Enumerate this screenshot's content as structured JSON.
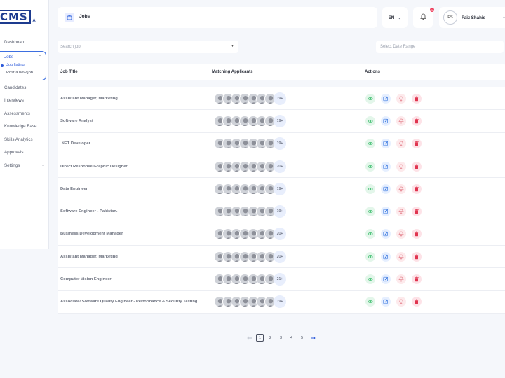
{
  "brand": {
    "logo_text": "CMS",
    "logo_suffix": ".AI"
  },
  "nav": {
    "dashboard": "Dashboard",
    "jobs": "Jobs",
    "job_listing": "Job listing",
    "post_job": "Post a new job",
    "candidates": "Candidates",
    "interviews": "Interviews",
    "assessments": "Assessments",
    "knowledge_base": "Knowledge Base",
    "skills_analytics": "Skills Analytics",
    "approvals": "Approvals",
    "settings": "Settings"
  },
  "header": {
    "title": "Jobs",
    "language": "EN",
    "notification_count": "1",
    "user_initials": "FS",
    "user_name": "Faiz Shahid"
  },
  "filters": {
    "search_placeholder": "Search job",
    "date_placeholder": "Select Date Range"
  },
  "table": {
    "columns": {
      "title": "Job Title",
      "applicants": "Matching Applicants",
      "actions": "Actions"
    },
    "rows": [
      {
        "title": "Assistant Manager, Marketing",
        "more": "19+"
      },
      {
        "title": "Software Analyst",
        "more": "19+"
      },
      {
        "title": ".NET Developer",
        "more": "19+"
      },
      {
        "title": "Direct Response Graphic Designer.",
        "more": "20+"
      },
      {
        "title": "Data Engineer",
        "more": "19+"
      },
      {
        "title": "Software Engineer - Pakistan.",
        "more": "19+"
      },
      {
        "title": "Business Development Manager",
        "more": "20+"
      },
      {
        "title": "Assistant Manager, Marketing",
        "more": "20+"
      },
      {
        "title": "Computer Vision Engineer",
        "more": "21+"
      },
      {
        "title": "Associate/ Software Quality Engineer - Performance & Security Testing.",
        "more": "19+"
      }
    ]
  },
  "pagination": {
    "pages": [
      "1",
      "2",
      "3",
      "4",
      "5"
    ],
    "current": "1"
  },
  "colors": {
    "accent": "#2b59d9",
    "view": "#3fbf6f",
    "edit": "#3d7be0",
    "share": "#e58a94",
    "delete": "#e0344f"
  }
}
